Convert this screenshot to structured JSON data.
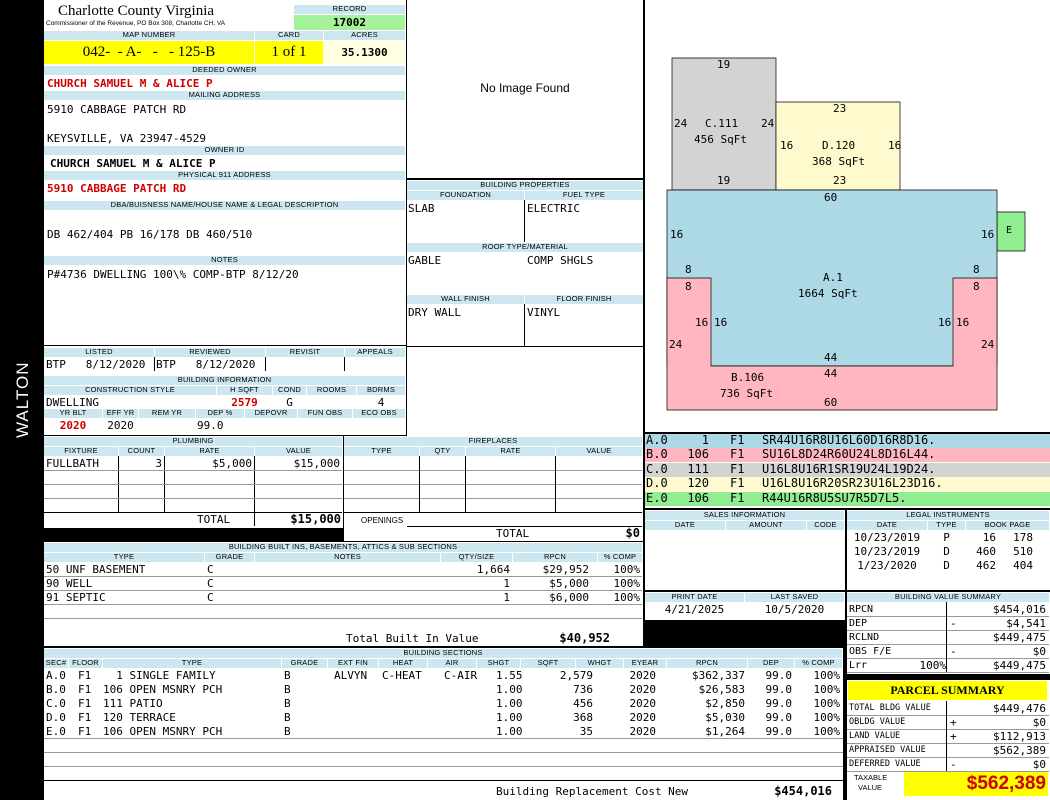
{
  "header": {
    "county": "Charlotte County Virginia",
    "commissioner": "Commissioner of the Revenue, PO Box 308, Charlotte CH, VA",
    "record_label": "RECORD",
    "record_value": "17002",
    "map_label": "MAP NUMBER",
    "map_value": "042-  - A-   -   - 125-B",
    "card_label": "CARD",
    "card_value": "1 of 1",
    "acres_label": "ACRES",
    "acres_value": "35.1300",
    "side_label": "WALTON"
  },
  "owner": {
    "deeded_label": "DEEDED OWNER",
    "deeded_value": "CHURCH SAMUEL M & ALICE P",
    "mailing_label": "MAILING ADDRESS",
    "mailing_line1": "5910 CABBAGE PATCH RD",
    "mailing_line2": "KEYSVILLE, VA 23947-4529",
    "owner_id_label": "OWNER ID",
    "owner_id_value": "CHURCH SAMUEL M & ALICE P",
    "physical_label": "PHYSICAL 911 ADDRESS",
    "physical_value": "5910 CABBAGE PATCH RD",
    "dba_label": "DBA/BUISNESS NAME/HOUSE NAME & LEGAL DESCRIPTION",
    "dba_value": "DB 462/404 PB 16/178 DB 460/510",
    "notes_label": "NOTES",
    "notes_value": "P#4736 DWELLING 100\\% COMP-BTP 8/12/20"
  },
  "photo": {
    "no_image": "No Image Found"
  },
  "building_props": {
    "title": "BUILDING PROPERTIES",
    "foundation_label": "FOUNDATION",
    "foundation_value": "SLAB",
    "fuel_label": "FUEL TYPE",
    "fuel_value": "ELECTRIC",
    "roof_label": "ROOF TYPE/MATERIAL",
    "roof_value1": "GABLE",
    "roof_value2": "COMP SHGLS",
    "wall_label": "WALL FINISH",
    "wall_value": "DRY WALL",
    "floor_label": "FLOOR FINISH",
    "floor_value": "VINYL"
  },
  "listing": {
    "listed_label": "LISTED",
    "listed_value": "BTP   8/12/2020",
    "reviewed_label": "REVIEWED",
    "reviewed_value": "BTP   8/12/2020",
    "revisit_label": "REVISIT",
    "appeals_label": "APPEALS"
  },
  "building_info": {
    "title": "BUILDING INFORMATION",
    "style_label": "CONSTRUCTION STYLE",
    "style_value": "DWELLING",
    "hsqft_label": "H SQFT",
    "hsqft_value": "2579",
    "cond_label": "COND",
    "cond_value": "G",
    "rooms_label": "ROOMS",
    "bdrms_label": "BDRMS",
    "bdrms_value": "4",
    "yrblt_label": "YR BLT",
    "yrblt_value": "2020",
    "effyr_label": "EFF YR",
    "effyr_value": "2020",
    "remyr_label": "REM YR",
    "dep_label": "DEP %",
    "dep_value": "99.0",
    "depovr_label": "DEPOVR",
    "funobs_label": "FUN OBS",
    "ecoobs_label": "ECO OBS"
  },
  "plumbing": {
    "title": "PLUMBING",
    "cols": [
      "FIXTURE",
      "COUNT",
      "RATE",
      "VALUE"
    ],
    "rows": [
      {
        "fixture": "FULLBATH",
        "count": "3",
        "rate": "$5,000",
        "value": "$15,000"
      }
    ],
    "total_label": "TOTAL",
    "total_value": "$15,000"
  },
  "fireplaces": {
    "title": "FIREPLACES",
    "cols": [
      "TYPE",
      "QTY",
      "RATE",
      "VALUE"
    ],
    "openings_label": "OPENINGS",
    "total_label": "TOTAL",
    "total_value": "$0"
  },
  "built_ins": {
    "title": "BUILDING BUILT INS, BASEMENTS, ATTICS & SUB SECTIONS",
    "cols": [
      "TYPE",
      "GRADE",
      "NOTES",
      "QTY/SIZE",
      "RPCN",
      "% COMP"
    ],
    "rows": [
      {
        "type": "50 UNF BASEMENT",
        "grade": "C",
        "qty": "1,664",
        "rpcn": "$29,952",
        "comp": "100%"
      },
      {
        "type": "90 WELL",
        "grade": "C",
        "qty": "1",
        "rpcn": "$5,000",
        "comp": "100%"
      },
      {
        "type": "91 SEPTIC",
        "grade": "C",
        "qty": "1",
        "rpcn": "$6,000",
        "comp": "100%"
      }
    ],
    "total_label": "Total Built In Value",
    "total_value": "$40,952"
  },
  "sections": {
    "title": "BUILDING SECTIONS",
    "cols": [
      "SEC#",
      "FLOOR",
      "TYPE",
      "GRADE",
      "EXT FIN",
      "HEAT",
      "AIR",
      "SHGT",
      "SQFT",
      "WHGT",
      "EYEAR",
      "RPCN",
      "DEP",
      "% COMP"
    ],
    "rows": [
      {
        "sec": "A.0",
        "floor": "F1",
        "type": "  1 SINGLE FAMILY",
        "grade": "B",
        "ext": "ALVYN",
        "heat": "C-HEAT",
        "air": "C-AIR",
        "shgt": "1.55",
        "sqft": "2,579",
        "eyear": "2020",
        "rpcn": "$362,337",
        "dep": "99.0",
        "comp": "100%"
      },
      {
        "sec": "B.0",
        "floor": "F1",
        "type": "106 OPEN MSNRY PCH",
        "grade": "B",
        "ext": "",
        "heat": "",
        "air": "",
        "shgt": "1.00",
        "sqft": "736",
        "eyear": "2020",
        "rpcn": "$26,583",
        "dep": "99.0",
        "comp": "100%"
      },
      {
        "sec": "C.0",
        "floor": "F1",
        "type": "111 PATIO",
        "grade": "B",
        "ext": "",
        "heat": "",
        "air": "",
        "shgt": "1.00",
        "sqft": "456",
        "eyear": "2020",
        "rpcn": "$2,850",
        "dep": "99.0",
        "comp": "100%"
      },
      {
        "sec": "D.0",
        "floor": "F1",
        "type": "120 TERRACE",
        "grade": "B",
        "ext": "",
        "heat": "",
        "air": "",
        "shgt": "1.00",
        "sqft": "368",
        "eyear": "2020",
        "rpcn": "$5,030",
        "dep": "99.0",
        "comp": "100%"
      },
      {
        "sec": "E.0",
        "floor": "F1",
        "type": "106 OPEN MSNRY PCH",
        "grade": "B",
        "ext": "",
        "heat": "",
        "air": "",
        "shgt": "1.00",
        "sqft": "35",
        "eyear": "2020",
        "rpcn": "$1,264",
        "dep": "99.0",
        "comp": "100%"
      }
    ],
    "replacement_label": "Building Replacement Cost New",
    "replacement_value": "$454,016"
  },
  "sketch": {
    "areas": [
      {
        "label": "A.1",
        "sqft": "1664 SqFt",
        "color": "#add8e6"
      },
      {
        "label": "B.106",
        "sqft": "736 SqFt",
        "color": "#ffb6c1"
      },
      {
        "label": "C.111",
        "sqft": "456 SqFt",
        "color": "#d3d3d3"
      },
      {
        "label": "D.120",
        "sqft": "368 SqFt",
        "color": "#fffacd"
      },
      {
        "label": "E",
        "sqft": "",
        "color": "#90ee90"
      }
    ],
    "dims": {
      "c_top": "19",
      "c_left": "24",
      "c_right": "24",
      "c_bottom": "19",
      "d_top": "23",
      "d_left": "16",
      "d_right": "16",
      "d_bottom": "23",
      "a_top": "60",
      "a_left": "16",
      "a_right": "16",
      "a_l8": "8",
      "a_r8": "8",
      "a_il16": "16",
      "a_ir16": "16",
      "a_bottom": "44",
      "b_l8": "8",
      "b_r8": "8",
      "b_left": "24",
      "b_right": "24",
      "b_il16": "16",
      "b_ir16": "16",
      "b_top": "44",
      "b_bottom": "60"
    },
    "vectors": [
      {
        "sec": "A.0",
        "num": "1",
        "floor": "F1",
        "code": "SR44U16R8U16L60D16R8D16.",
        "color": "#add8e6"
      },
      {
        "sec": "B.0",
        "num": "106",
        "floor": "F1",
        "code": "SU16L8D24R60U24L8D16L44.",
        "color": "#ffb6c1"
      },
      {
        "sec": "C.0",
        "num": "111",
        "floor": "F1",
        "code": "U16L8U16R1SR19U24L19D24.",
        "color": "#d3d3d3"
      },
      {
        "sec": "D.0",
        "num": "120",
        "floor": "F1",
        "code": "U16L8U16R20SR23U16L23D16.",
        "color": "#fffacd"
      },
      {
        "sec": "E.0",
        "num": "106",
        "floor": "F1",
        "code": "R44U16R8U5SU7R5D7L5.",
        "color": "#90ee90"
      }
    ]
  },
  "sales": {
    "title": "SALES INFORMATION",
    "cols": [
      "DATE",
      "AMOUNT",
      "CODE"
    ]
  },
  "legal": {
    "title": "LEGAL INSTRUMENTS",
    "cols": [
      "DATE",
      "TYPE",
      "BOOK PAGE"
    ],
    "rows": [
      {
        "date": "10/23/2019",
        "type": "P",
        "book": "16",
        "page": "178"
      },
      {
        "date": "10/23/2019",
        "type": "D",
        "book": "460",
        "page": "510"
      },
      {
        "date": "1/23/2020",
        "type": "D",
        "book": "462",
        "page": "404"
      }
    ]
  },
  "print": {
    "print_label": "PRINT DATE",
    "print_value": "4/21/2025",
    "saved_label": "LAST SAVED",
    "saved_value": "10/5/2020"
  },
  "value_summary": {
    "title": "BUILDING VALUE SUMMARY",
    "rows": [
      {
        "label": "RPCN",
        "sign": "",
        "pct": "",
        "value": "$454,016"
      },
      {
        "label": "DEP",
        "sign": "-",
        "pct": "",
        "value": "$4,541"
      },
      {
        "label": "RCLND",
        "sign": "",
        "pct": "",
        "value": "$449,475"
      },
      {
        "label": "OBS F/E",
        "sign": "-",
        "pct": "",
        "value": "$0"
      },
      {
        "label": "Lrr",
        "sign": "",
        "pct": "100%",
        "value": "$449,475"
      }
    ]
  },
  "parcel": {
    "title": "PARCEL SUMMARY",
    "rows": [
      {
        "label": "TOTAL BLDG VALUE",
        "sign": "",
        "value": "$449,476"
      },
      {
        "label": "OBLDG VALUE",
        "sign": "+",
        "value": "$0"
      },
      {
        "label": "LAND VALUE",
        "sign": "+",
        "value": "$112,913"
      },
      {
        "label": "APPRAISED VALUE",
        "sign": "",
        "value": "$562,389"
      },
      {
        "label": "DEFERRED VALUE",
        "sign": "-",
        "value": "$0"
      }
    ],
    "taxable_label1": "TAXABLE",
    "taxable_label2": "VALUE",
    "taxable_value": "$562,389"
  },
  "colors": {
    "header_blue": "#cde7f0",
    "record_green": "#a6f29a",
    "map_yellow": "#ffff00",
    "acres_cream": "#ffffe0",
    "accent_red": "#d00000"
  }
}
